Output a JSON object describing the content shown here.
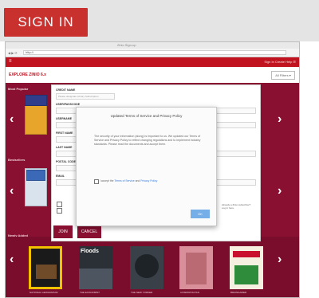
{
  "top": {
    "sign_in": "SIGN IN"
  },
  "browser": {
    "tab_title": "Zinio Sign-up",
    "url": "http://",
    "nav": "◀ ▶ ⟳"
  },
  "app": {
    "menu_icon": "≡",
    "header_links": "Sign In   Create   Help   ☰",
    "brand": "EXPLORE ZINIO 6.x",
    "filter": "All Filters ▾",
    "sections": [
      "Most Popular",
      "Bestsellers",
      "Newly Added"
    ]
  },
  "form": {
    "fields": [
      "CREDIT NAME",
      "USER/PASSCODE",
      "USERNAME",
      "FIRST NAME",
      "LAST NAME",
      "POSTAL CODE",
      "EMAIL"
    ],
    "placeholders": [
      "Please designate Library Subscription",
      "",
      "",
      "",
      "",
      "",
      ""
    ],
    "join_label": "JOIN",
    "cancel_label": "CANCEL",
    "side_note": "Already a Zinio subscriber? Log in here."
  },
  "modal": {
    "title": "Updated Terms of Service and Privacy Policy",
    "body": "The security of your information (along) is important to us. We updated our Terms of Service and Privacy Policy to reflect changing regulations and to implement industry standards. Please read the documents and accept them.",
    "check_prefix": "I accept the ",
    "check_link_1": "Terms of Service",
    "check_mid": " and ",
    "check_link_2": "Privacy Policy",
    "ok_label": "OK"
  },
  "magazines_row3": [
    {
      "title": "",
      "caption": "NATIONAL GEOGRAPHIC"
    },
    {
      "title": "Floods",
      "caption": "THE ECONOMIST"
    },
    {
      "title": "",
      "caption": "THE NEW YORKER"
    },
    {
      "title": "",
      "caption": "COSMOPOLITAN"
    },
    {
      "title": "",
      "caption": "BRAINGAMER"
    }
  ],
  "colors": {
    "brand_red": "#c1121f",
    "maroon": "#8a1032",
    "sign_in_red": "#c9312f",
    "ok_blue": "#76aee8"
  }
}
